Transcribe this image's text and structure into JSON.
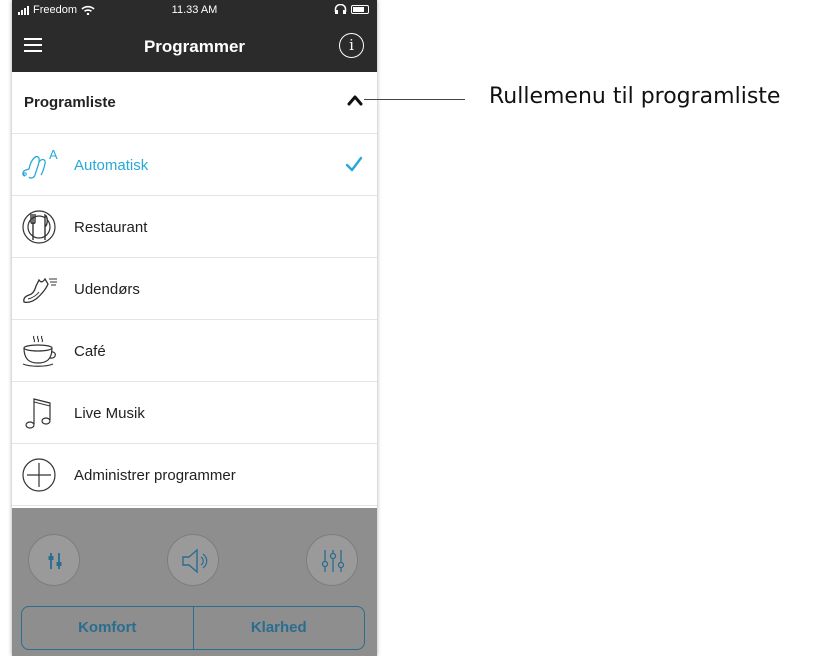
{
  "status_bar": {
    "carrier": "Freedom",
    "time": "11.33 AM"
  },
  "nav": {
    "title": "Programmer",
    "menu_icon": "hamburger-menu-icon",
    "info_icon": "info-icon",
    "info_glyph": "i"
  },
  "list_header": {
    "label": "Programliste",
    "state_icon": "chevron-up-icon"
  },
  "programs": [
    {
      "label": "Automatisk",
      "icon": "hearing-aid-auto-icon",
      "selected": true
    },
    {
      "label": "Restaurant",
      "icon": "plate-cutlery-icon",
      "selected": false
    },
    {
      "label": "Udendørs",
      "icon": "running-shoe-icon",
      "selected": false
    },
    {
      "label": "Café",
      "icon": "coffee-cup-icon",
      "selected": false
    },
    {
      "label": "Live Musik",
      "icon": "music-note-icon",
      "selected": false
    },
    {
      "label": "Administrer programmer",
      "icon": "plus-circle-icon",
      "selected": false
    }
  ],
  "controls": {
    "left_button_icon": "adjust-sliders-icon",
    "middle_button_icon": "speaker-icon",
    "right_button_icon": "equalizer-icon",
    "segments": [
      "Komfort",
      "Klarhed"
    ]
  },
  "annotation": {
    "text": "Rullemenu til programliste"
  },
  "colors": {
    "accent": "#28a9d8",
    "nav_background": "#2b2b2b",
    "segment_border": "#2a6d8f",
    "overlay": "#8e8e8e"
  }
}
